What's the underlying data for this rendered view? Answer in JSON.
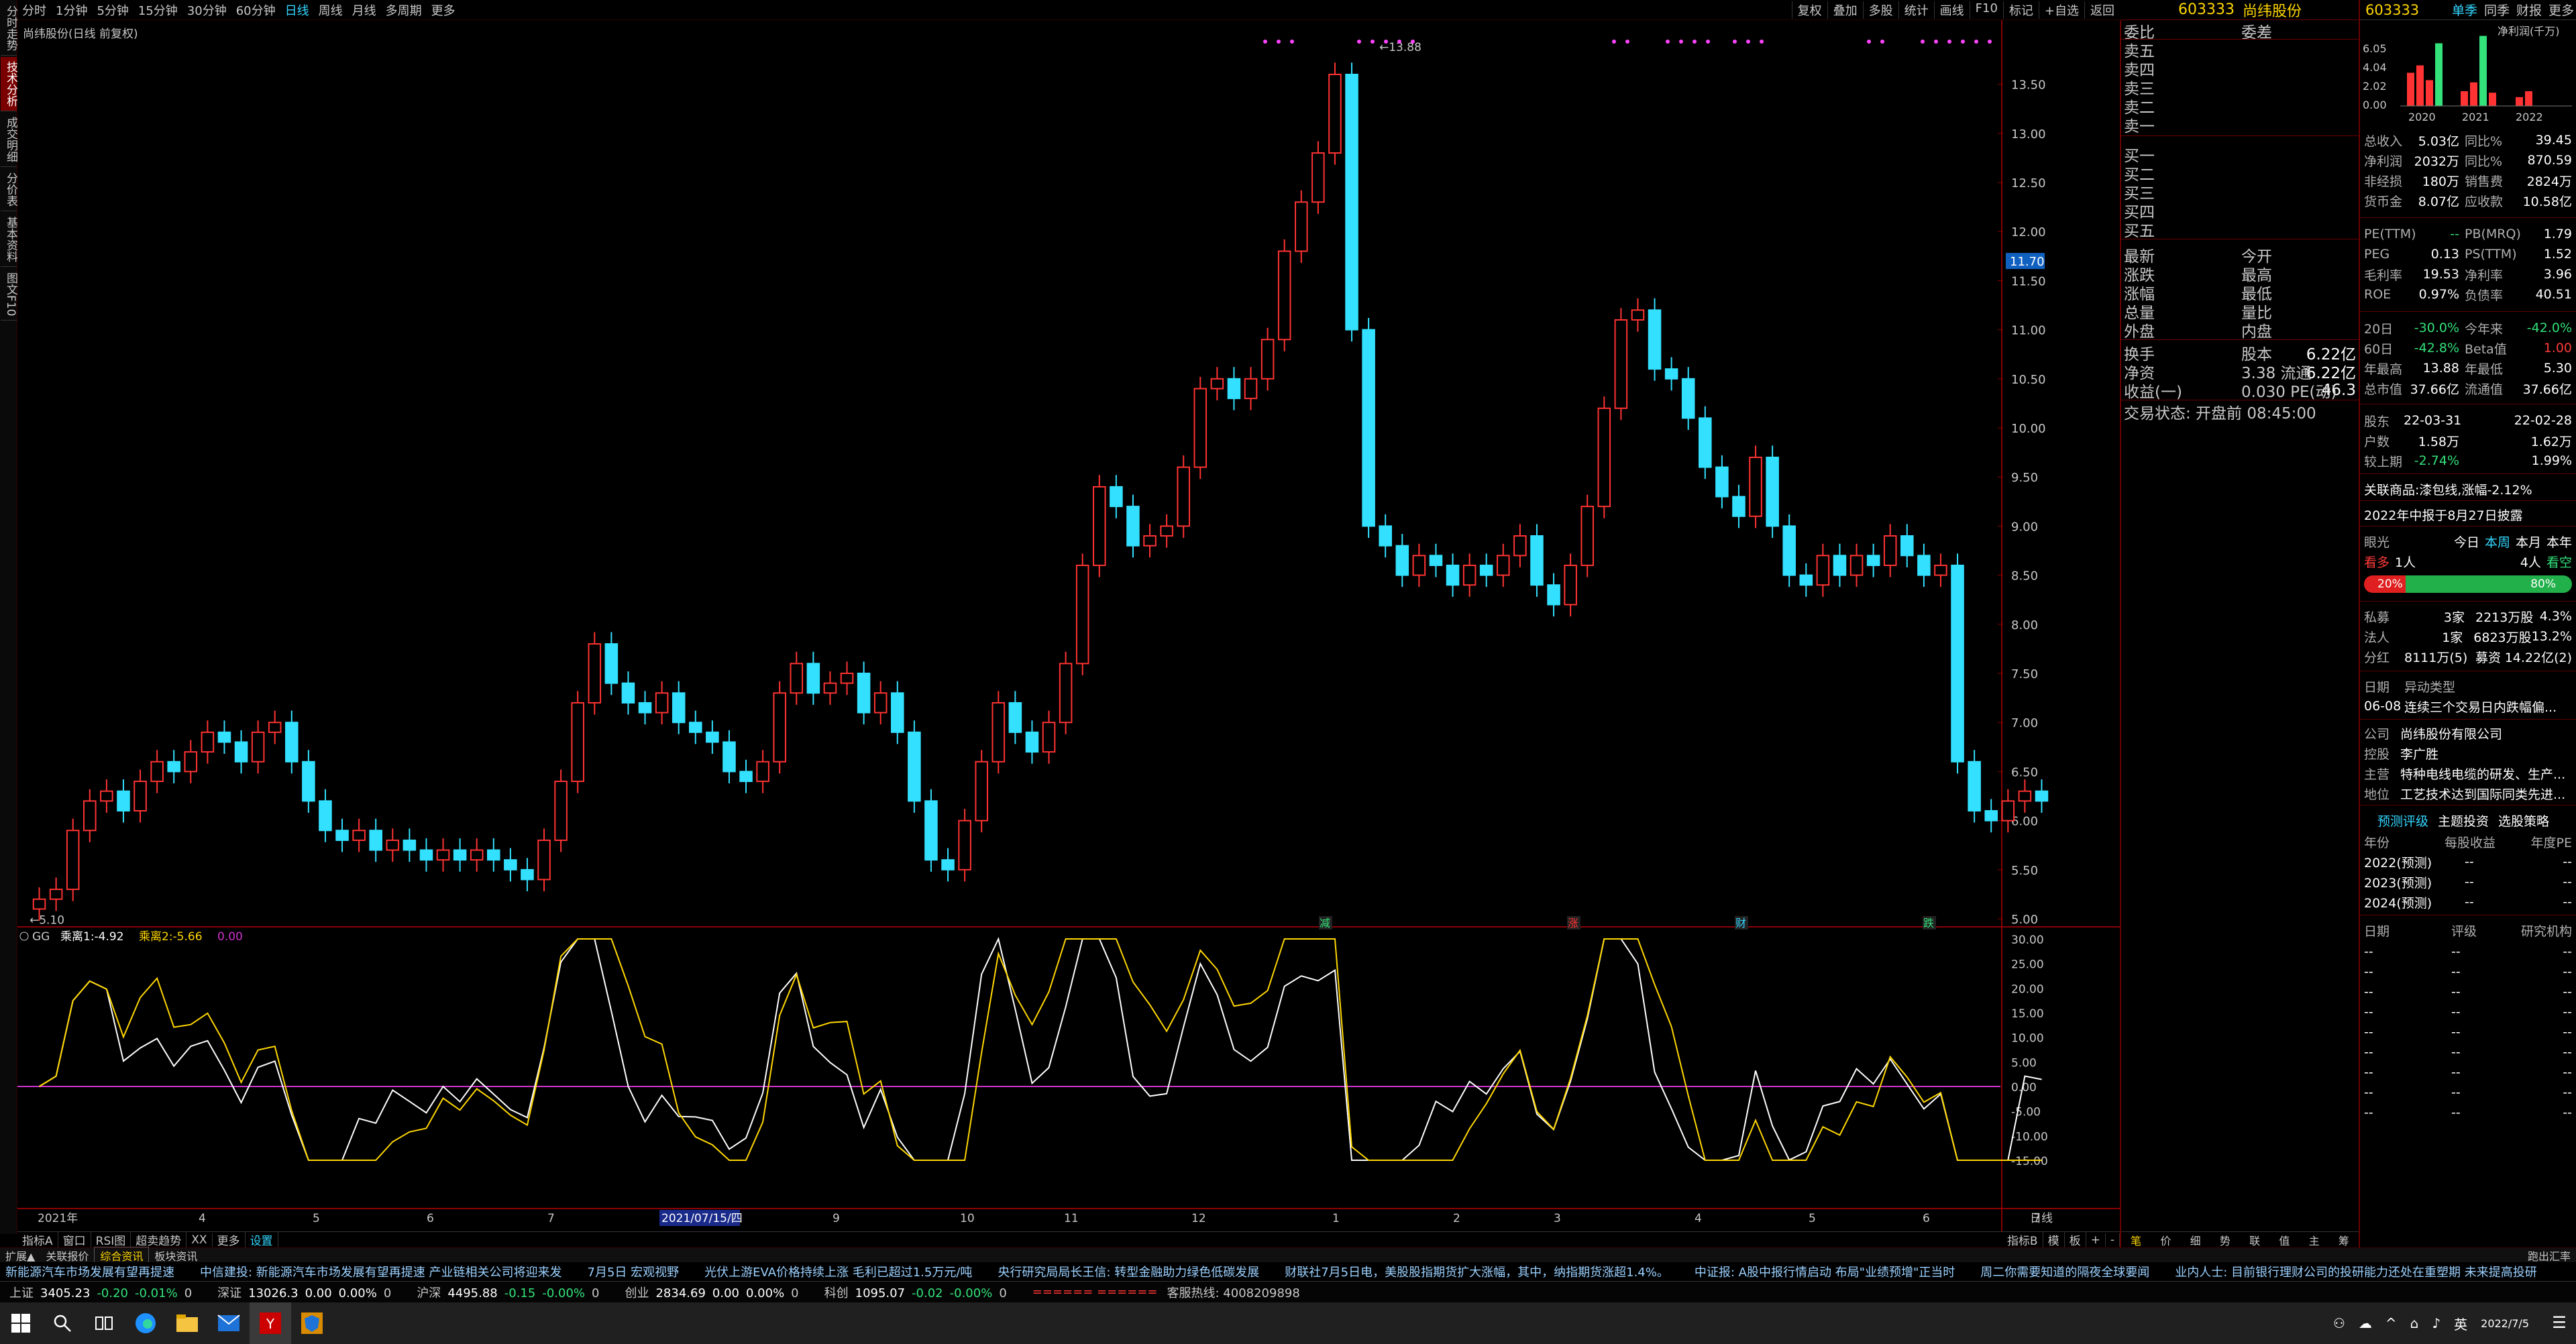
{
  "left_strip": [
    "分时走势",
    "技术分析",
    "成交明细",
    "分价表",
    "基本资料",
    "图文F10"
  ],
  "toolbar": {
    "periods": [
      "分时",
      "1分钟",
      "5分钟",
      "15分钟",
      "30分钟",
      "60分钟",
      "日线",
      "周线",
      "月线",
      "多周期",
      "更多"
    ],
    "active_period": "日线",
    "right_items": [
      "复权",
      "叠加",
      "多股",
      "统计",
      "画线",
      "F10",
      "标记",
      "+自选",
      "返回"
    ]
  },
  "chart": {
    "title": "尚纬股份(日线 前复权)",
    "price_axis": [
      "13.50",
      "13.00",
      "12.50",
      "12.00",
      "11.50",
      "11.00",
      "10.50",
      "10.00",
      "9.50",
      "9.00",
      "8.50",
      "8.00",
      "7.50",
      "7.00",
      "6.50",
      "6.00",
      "5.50",
      "5.00"
    ],
    "current_price_tag": "11.70",
    "high_label": "13.88",
    "low_label": "5.10",
    "event_markers": [
      "减",
      "涨",
      "财",
      "跌"
    ],
    "indicator_label": "GG",
    "indicator_values": [
      {
        "label": "乘离1:",
        "value": "-4.92",
        "color": "#ffffff"
      },
      {
        "label": "乘离2:",
        "value": "-5.66",
        "color": "#ffd700"
      },
      {
        "label": "",
        "value": "0.00",
        "color": "#cc33cc"
      }
    ],
    "indicator_axis": [
      "30.00",
      "25.00",
      "20.00",
      "15.00",
      "10.00",
      "5.00",
      "0.00",
      "-5.00",
      "-10.00",
      "-15.00"
    ],
    "time_axis": [
      "2021年",
      "4",
      "5",
      "6",
      "7",
      "2021/07/15/四",
      "9",
      "10",
      "11",
      "12",
      "1",
      "2",
      "3",
      "4",
      "5",
      "6",
      "7"
    ],
    "time_axis_right_label": "日线"
  },
  "chart_data": {
    "type": "candlestick",
    "ylim": [
      5.0,
      13.88
    ],
    "y_min_label": 5.1,
    "y_max_label": 13.88,
    "series_close_approx": [
      5.2,
      5.3,
      5.9,
      6.2,
      6.3,
      6.1,
      6.4,
      6.6,
      6.5,
      6.7,
      6.9,
      6.8,
      6.6,
      6.9,
      7.0,
      6.6,
      6.2,
      5.9,
      5.8,
      5.9,
      5.7,
      5.8,
      5.7,
      5.6,
      5.7,
      5.6,
      5.7,
      5.6,
      5.5,
      5.4,
      5.8,
      6.4,
      7.2,
      7.8,
      7.4,
      7.2,
      7.1,
      7.3,
      7.0,
      6.9,
      6.8,
      6.5,
      6.4,
      6.6,
      7.3,
      7.6,
      7.3,
      7.4,
      7.5,
      7.1,
      7.3,
      6.9,
      6.2,
      5.6,
      5.5,
      6.0,
      6.6,
      7.2,
      6.9,
      6.7,
      7.0,
      7.6,
      8.6,
      9.4,
      9.2,
      8.8,
      8.9,
      9.0,
      9.6,
      10.4,
      10.5,
      10.3,
      10.5,
      10.9,
      11.8,
      12.3,
      12.8,
      13.6,
      11.0,
      9.0,
      8.8,
      8.5,
      8.7,
      8.6,
      8.4,
      8.6,
      8.5,
      8.7,
      8.9,
      8.4,
      8.2,
      8.6,
      9.2,
      10.2,
      11.1,
      11.2,
      10.6,
      10.5,
      10.1,
      9.6,
      9.3,
      9.1,
      9.7,
      9.0,
      8.5,
      8.4,
      8.7,
      8.5,
      8.7,
      8.6,
      8.9,
      8.7,
      8.5,
      8.6,
      6.6,
      6.1,
      6.0,
      6.2,
      6.3,
      6.2
    ]
  },
  "quote_panel": {
    "rows": [
      {
        "l": "委比",
        "c": "委差",
        "r": ""
      },
      {
        "l": "卖五",
        "c": "",
        "r": ""
      },
      {
        "l": "卖四",
        "c": "",
        "r": ""
      },
      {
        "l": "卖三",
        "c": "",
        "r": ""
      },
      {
        "l": "卖二",
        "c": "",
        "r": ""
      },
      {
        "l": "卖一",
        "c": "",
        "r": ""
      },
      {
        "l": "买一",
        "c": "",
        "r": ""
      },
      {
        "l": "买二",
        "c": "",
        "r": ""
      },
      {
        "l": "买三",
        "c": "",
        "r": ""
      },
      {
        "l": "买四",
        "c": "",
        "r": ""
      },
      {
        "l": "买五",
        "c": "",
        "r": ""
      },
      {
        "l": "最新",
        "c": "今开",
        "r": ""
      },
      {
        "l": "涨跌",
        "c": "最高",
        "r": ""
      },
      {
        "l": "涨幅",
        "c": "最低",
        "r": ""
      },
      {
        "l": "总量",
        "c": "量比",
        "r": ""
      },
      {
        "l": "外盘",
        "c": "内盘",
        "r": ""
      },
      {
        "l": "换手",
        "c": "股本",
        "r": "6.22亿"
      },
      {
        "l": "净资",
        "c": "3.38  流通",
        "r": "6.22亿"
      },
      {
        "l": "收益(一)",
        "c": "0.030  PE(动)",
        "r": "46.3"
      },
      {
        "l": "交易状态: 开盘前 08:45:00",
        "c": "",
        "r": ""
      }
    ]
  },
  "f10": {
    "code": "603333",
    "name": "尚纬股份",
    "tabs": [
      "单季",
      "同季",
      "财报",
      "更多"
    ],
    "chart_label": "净利润(千万)",
    "chart_years": [
      "2020",
      "2021",
      "2022"
    ],
    "chart_axis": [
      "6.05",
      "4.04",
      "2.02",
      "0.00"
    ],
    "rows": [
      {
        "k": "总收入",
        "v": "5.03亿",
        "k2": "同比%",
        "v2": "39.45"
      },
      {
        "k": "净利润",
        "v": "2032万",
        "k2": "同比%",
        "v2": "870.59"
      },
      {
        "k": "非经损",
        "v": "180万",
        "k2": "销售费",
        "v2": "2824万"
      },
      {
        "k": "货币金",
        "v": "8.07亿",
        "k2": "应收款",
        "v2": "10.58亿"
      },
      {
        "k": "PE(TTM)",
        "v": "--",
        "k2": "PB(MRQ)",
        "v2": "1.79"
      },
      {
        "k": "PEG",
        "v": "0.13",
        "k2": "PS(TTM)",
        "v2": "1.52"
      },
      {
        "k": "毛利率",
        "v": "19.53",
        "k2": "净利率",
        "v2": "3.96"
      },
      {
        "k": "ROE",
        "v": "0.97%",
        "k2": "负债率",
        "v2": "40.51"
      },
      {
        "k": "20日",
        "v": "-30.0%",
        "k2": "今年来",
        "v2": "-42.0%"
      },
      {
        "k": "60日",
        "v": "-42.8%",
        "k2": "Beta值",
        "v2": "1.00"
      },
      {
        "k": "年最高",
        "v": "13.88",
        "k2": "年最低",
        "v2": "5.30"
      },
      {
        "k": "总市值",
        "v": "37.66亿",
        "k2": "流通值",
        "v2": "37.66亿"
      },
      {
        "k": "股东",
        "v": "22-03-31",
        "k2": "",
        "v2": "22-02-28"
      },
      {
        "k": "户数",
        "v": "1.58万",
        "k2": "",
        "v2": "1.62万"
      },
      {
        "k": "较上期",
        "v": "-2.74%",
        "k2": "",
        "v2": "1.99%"
      }
    ],
    "related": "关联商品:漆包线,涨幅-2.12%",
    "report_note": "2022年中报于8月27日披露",
    "eyes": {
      "label": "眼光",
      "today": "今日",
      "week": "本周",
      "month": "本月",
      "year": "本年",
      "bull": "看多",
      "bull_n": "1人",
      "bear_n": "4人",
      "bear": "看空",
      "pct_bull": "20%",
      "pct_bear": "80%"
    },
    "holders": [
      {
        "k": "私募",
        "v": "3家",
        "v2": "2213万股",
        "v3": "4.3%"
      },
      {
        "k": "法人",
        "v": "1家",
        "v2": "6823万股",
        "v3": "13.2%"
      },
      {
        "k": "分红",
        "v": "8111万(5)",
        "v2": "募资",
        "v3": "14.22亿(2)"
      }
    ],
    "abnormal_hdr": {
      "k": "日期",
      "v": "异动类型"
    },
    "abnormal": {
      "date": "06-08",
      "text": "连续三个交易日内跌幅偏..."
    },
    "company": [
      {
        "k": "公司",
        "v": "尚纬股份有限公司"
      },
      {
        "k": "控股",
        "v": "李广胜"
      },
      {
        "k": "主营",
        "v": "特种电线电缆的研发、生产..."
      },
      {
        "k": "地位",
        "v": "工艺技术达到国际同类先进..."
      }
    ],
    "forecast_tabs": [
      "预测评级",
      "主题投资",
      "选股策略"
    ],
    "forecast_hdr": [
      "年份",
      "每股收益",
      "年度PE"
    ],
    "forecast": [
      {
        "y": "2022(预测)",
        "eps": "--",
        "pe": "--"
      },
      {
        "y": "2023(预测)",
        "eps": "--",
        "pe": "--"
      },
      {
        "y": "2024(预测)",
        "eps": "--",
        "pe": "--"
      }
    ],
    "rating_hdr": [
      "日期",
      "评级",
      "研究机构"
    ],
    "ratings": [
      "--",
      "--",
      "--",
      "--",
      "--",
      "--",
      "--",
      "--",
      "--"
    ]
  },
  "indicator_tabs": [
    "指标A",
    "窗口",
    "RSI图",
    "超卖趋势",
    "XX",
    "更多",
    "设置"
  ],
  "indicator_tabs_right": [
    "指标B",
    "模",
    "板",
    "+",
    "-"
  ],
  "quote_bottom_tabs": [
    "笔",
    "价",
    "细",
    "势",
    "联",
    "值",
    "主",
    "筹"
  ],
  "news_tabs": [
    "扩展▲",
    "关联报价",
    "综合资讯",
    "板块资讯"
  ],
  "news_tabs_right": "跑出汇率",
  "news": [
    "新能源汽车市场发展有望再提速",
    "中信建投: 新能源汽车市场发展有望再提速 产业链相关公司将迎来发",
    "7月5日 宏观视野",
    "光伏上游EVA价格持续上涨 毛利已超过1.5万元/吨",
    "央行研究局局长王信: 转型金融助力绿色低碳发展",
    "财联社7月5日电，美股股指期货扩大涨幅，其中，纳指期货涨超1.4%。",
    "中证报: A股中报行情启动 布局\"业绩预增\"正当时",
    "周二你需要知道的隔夜全球要闻",
    "业内人士: 目前银行理财公司的投研能力还处在重塑期 未来提高投研"
  ],
  "indices": [
    {
      "n": "上证",
      "v": "3405.23",
      "c": "-0.20",
      "p": "-0.01%",
      "a": "0"
    },
    {
      "n": "深证",
      "v": "13026.3",
      "c": "0.00",
      "p": "0.00%",
      "a": "0"
    },
    {
      "n": "沪深",
      "v": "4495.88",
      "c": "-0.15",
      "p": "-0.00%",
      "a": "0"
    },
    {
      "n": "创业",
      "v": "2834.69",
      "c": "0.00",
      "p": "0.00%",
      "a": "0"
    },
    {
      "n": "科创",
      "v": "1095.07",
      "c": "-0.02",
      "p": "-0.00%",
      "a": "0"
    }
  ],
  "hotline": "客服热线: 4008209898",
  "tray": {
    "lang": "英",
    "date": "2022/7/5"
  }
}
